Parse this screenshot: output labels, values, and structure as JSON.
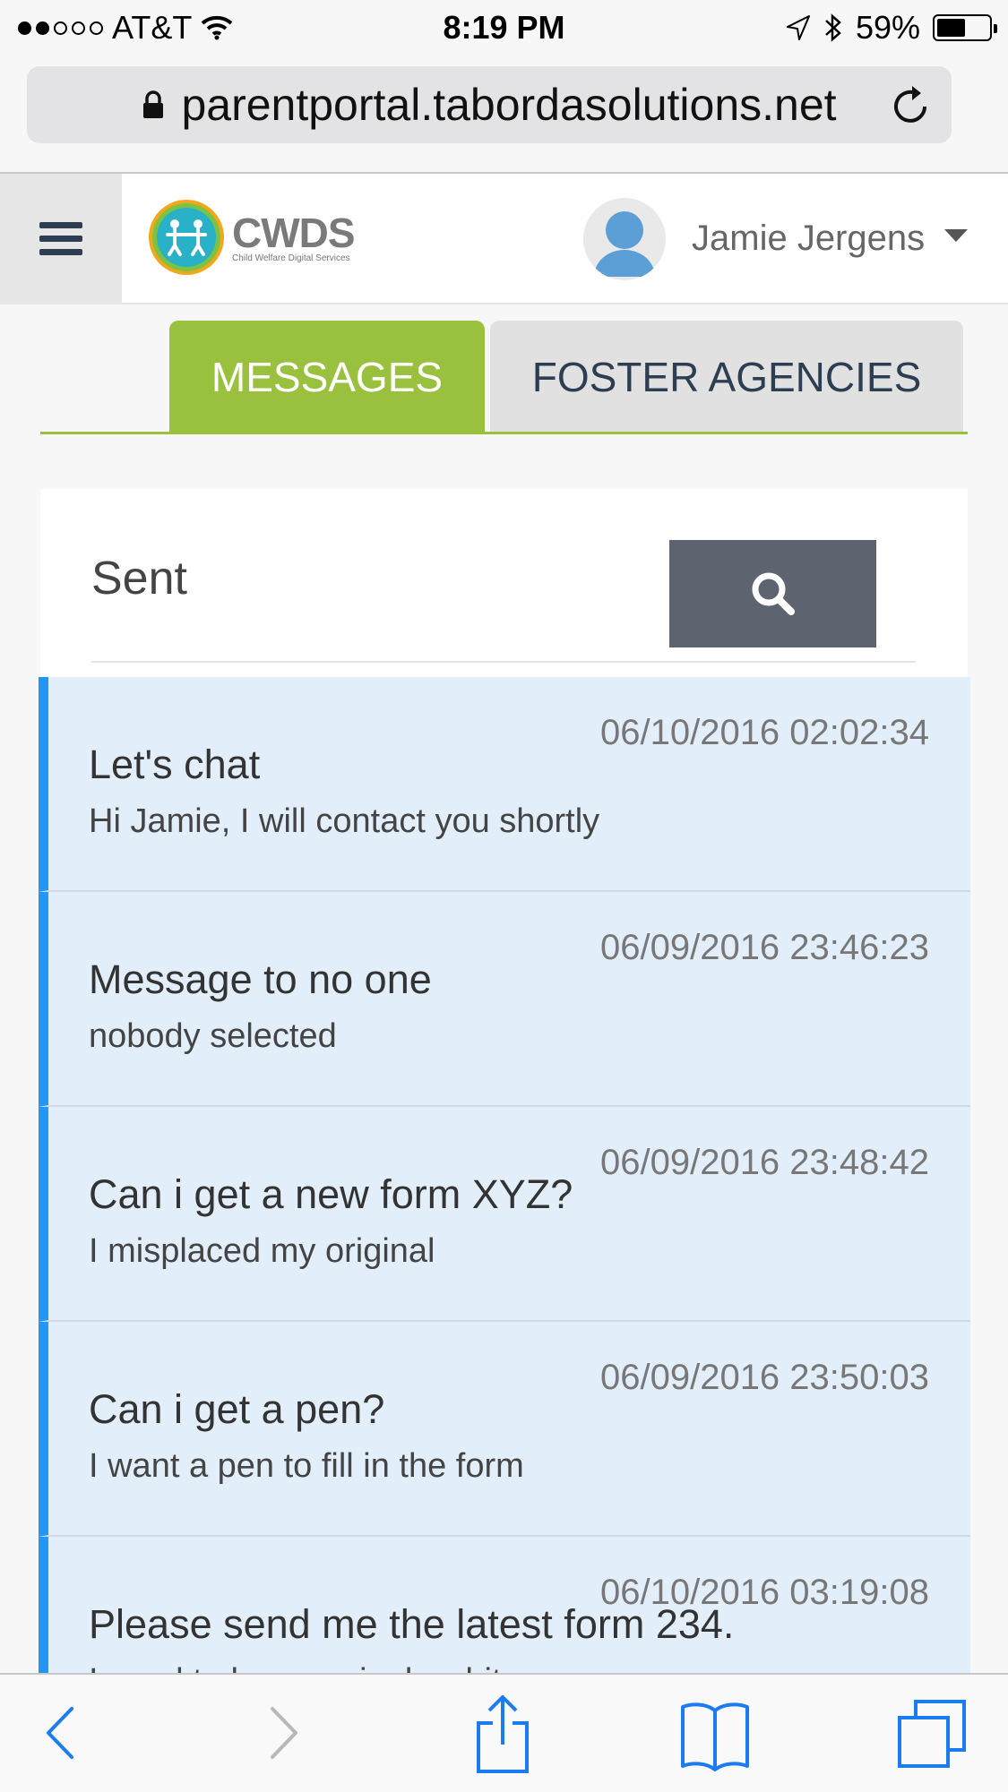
{
  "status_bar": {
    "carrier": "AT&T",
    "time": "8:19 PM",
    "battery": "59%",
    "battery_level": 0.59
  },
  "browser": {
    "url": "parentportal.tabordasolutions.net"
  },
  "header": {
    "logo_name": "CWDS",
    "logo_subtitle": "Child Welfare Digital Services",
    "user_name": "Jamie Jergens"
  },
  "tabs": [
    {
      "label": "MESSAGES",
      "active": true
    },
    {
      "label": "FOSTER AGENCIES",
      "active": false
    }
  ],
  "panel": {
    "title": "Sent"
  },
  "messages": [
    {
      "subject": "Let's chat",
      "body": "Hi Jamie, I will contact you shortly",
      "date": "06/10/2016 02:02:34"
    },
    {
      "subject": "Message to no one",
      "body": "nobody selected",
      "date": "06/09/2016 23:46:23"
    },
    {
      "subject": "Can i get a new form XYZ?",
      "body": "I misplaced my original",
      "date": "06/09/2016 23:48:42"
    },
    {
      "subject": "Can i get a pen?",
      "body": "I want a pen to fill in the form",
      "date": "06/09/2016 23:50:03"
    },
    {
      "subject": "Please send me the latest form 234.",
      "body": "I need to have a single white",
      "date": "06/10/2016 03:19:08"
    }
  ],
  "colors": {
    "accent_green": "#9ac13d",
    "message_bg": "#e2effa",
    "message_accent": "#2196f3",
    "search_button": "#5d6470"
  }
}
